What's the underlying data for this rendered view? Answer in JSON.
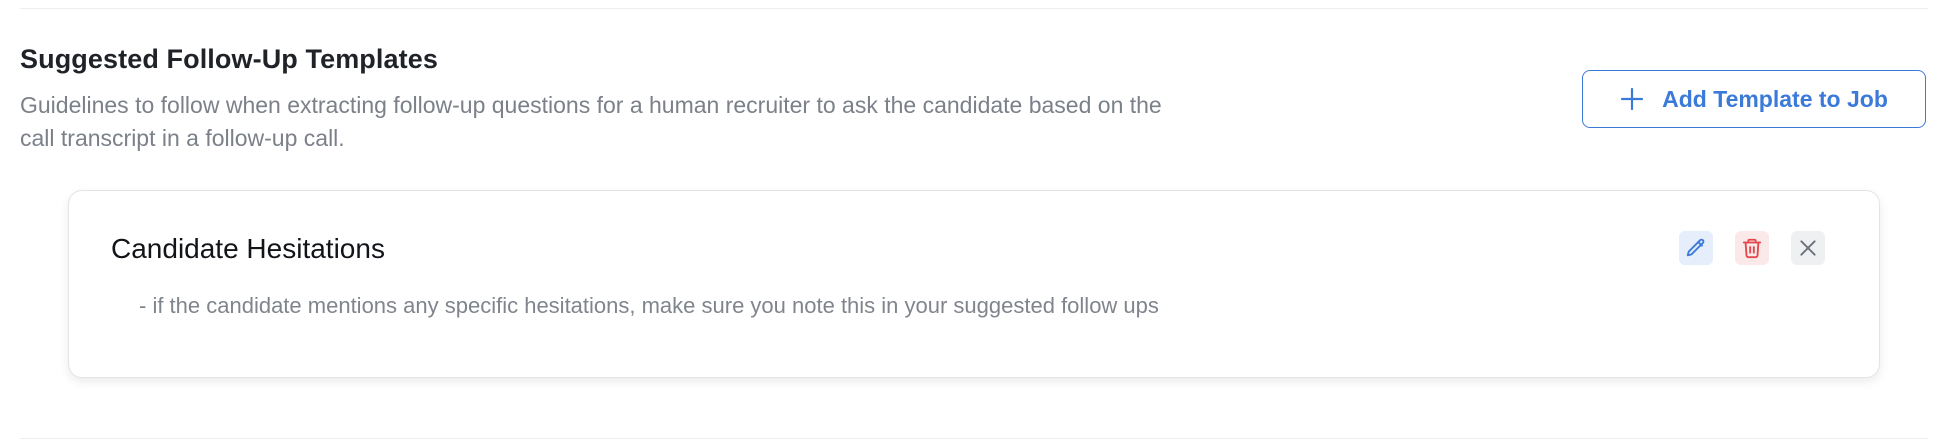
{
  "section": {
    "title": "Suggested Follow-Up Templates",
    "description": "Guidelines to follow when extracting follow-up questions for a human recruiter to ask the candidate based on the call transcript in a follow-up call."
  },
  "actions": {
    "add_template_label": "Add Template to Job",
    "add_template_icon": "plus-icon"
  },
  "templates": [
    {
      "title": "Candidate Hesitations",
      "body": "- if the candidate mentions any specific hesitations, make sure you note this in your suggested follow ups",
      "actions": [
        {
          "name": "edit",
          "icon": "pencil-icon"
        },
        {
          "name": "delete",
          "icon": "trash-icon"
        },
        {
          "name": "remove",
          "icon": "close-icon"
        }
      ]
    }
  ],
  "colors": {
    "accent": "#3c7ad9",
    "danger": "#e0484b",
    "muted": "#7b8089"
  }
}
